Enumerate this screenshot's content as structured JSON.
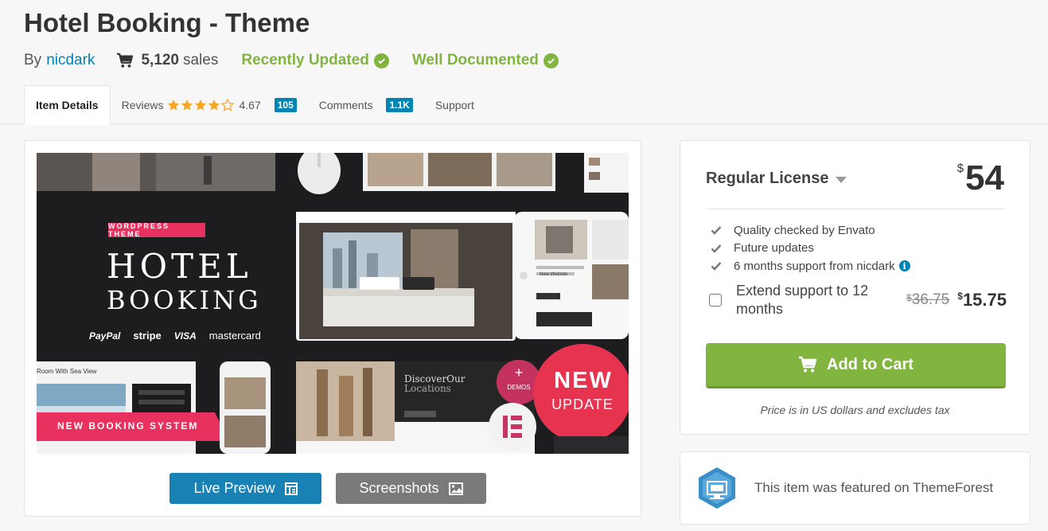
{
  "item": {
    "title": "Hotel Booking - Theme",
    "by_label": "By",
    "author": "nicdark",
    "sales_count": "5,120",
    "sales_label": "sales",
    "badges": [
      "Recently Updated",
      "Well Documented"
    ]
  },
  "tabs": [
    {
      "label": "Item Details",
      "active": true
    },
    {
      "label": "Reviews",
      "rating": "4.67",
      "rating_value": 4.67,
      "count": "105"
    },
    {
      "label": "Comments",
      "count": "1.1K"
    },
    {
      "label": "Support"
    }
  ],
  "preview": {
    "banner_tag": "WORDPRESS THEME",
    "banner_title_1": "HOTEL",
    "banner_title_2": "BOOKING",
    "payment_logos": [
      "PayPal",
      "stripe",
      "VISA",
      "mastercard"
    ],
    "new_booking_ribbon": "NEW BOOKING SYSTEM",
    "demos_label": "DEMOS",
    "new_label": "NEW",
    "update_label": "UPDATE",
    "sea_view_text": "Room With Sea View",
    "discover_1": "DiscoverOur",
    "discover_2": "Locations",
    "new_website_text": "New Website",
    "buttons": {
      "live_preview": "Live Preview",
      "screenshots": "Screenshots"
    }
  },
  "purchase": {
    "license_label": "Regular License",
    "currency": "$",
    "price": "54",
    "features": [
      "Quality checked by Envato",
      "Future updates",
      "6 months support from nicdark"
    ],
    "extend_label": "Extend support to 12 months",
    "extend_checked": false,
    "old_price": "36.75",
    "new_price": "15.75",
    "add_to_cart": "Add to Cart",
    "tax_note": "Price is in US dollars and excludes tax"
  },
  "featured": {
    "text": "This item was featured on ThemeForest"
  },
  "colors": {
    "accent_green": "#82b440",
    "link_blue": "#0084b4",
    "preview_btn": "#1982b5",
    "shots_btn": "#7a7a7a",
    "ribbon_pink": "#e8315f",
    "star": "#f5a623"
  }
}
